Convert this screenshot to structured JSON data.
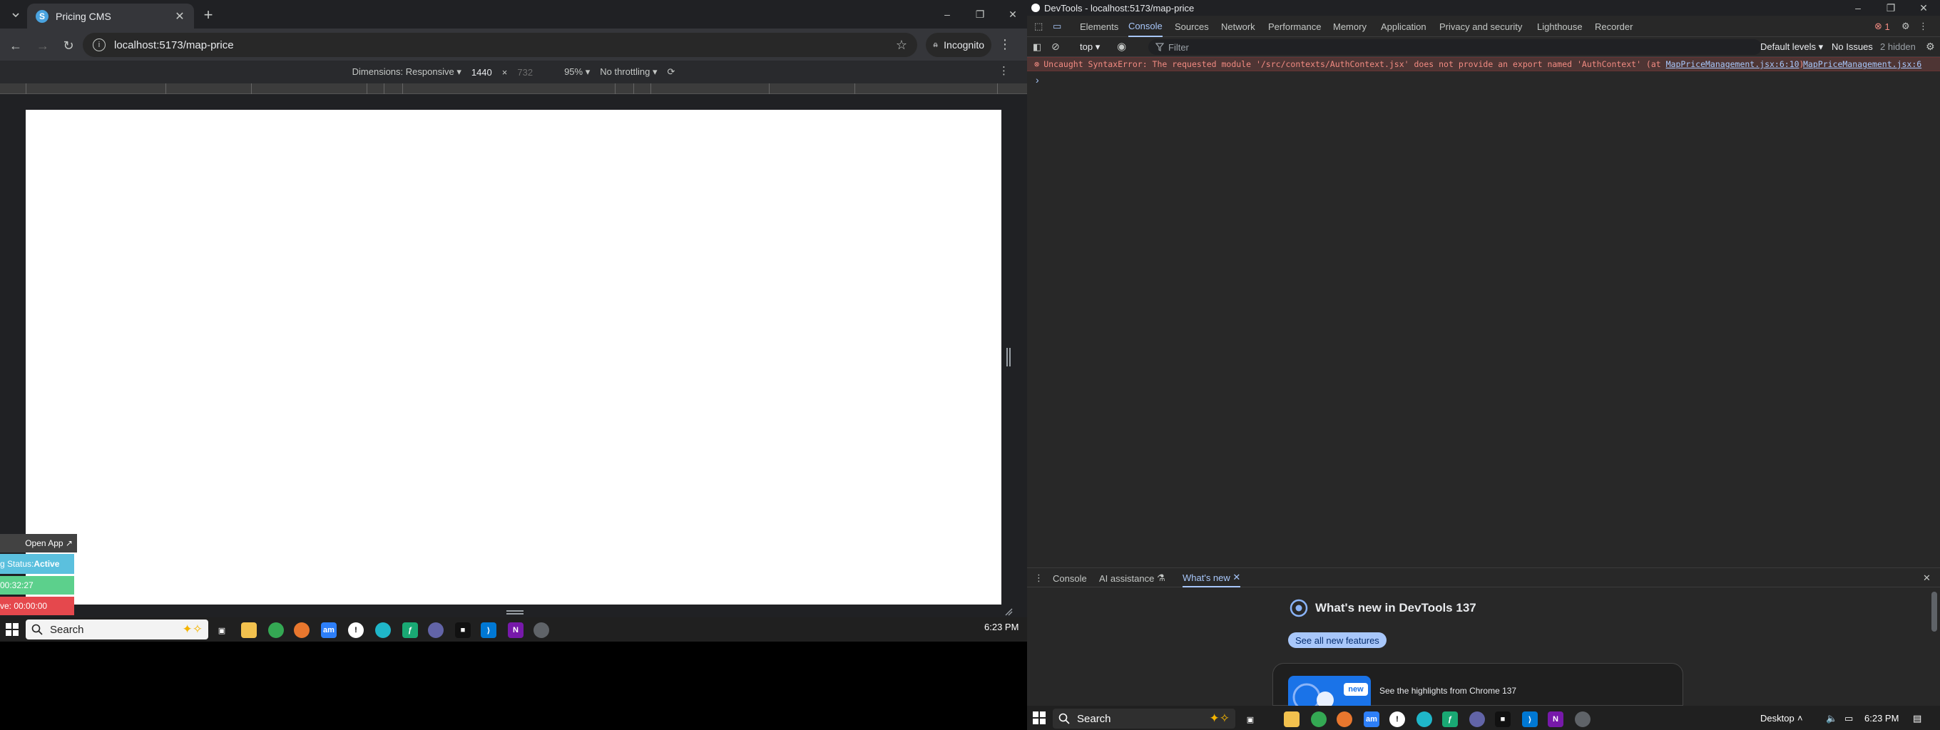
{
  "browser": {
    "tab_title": "Pricing CMS",
    "tab_favicon": "S",
    "url": "localhost:5173/map-price",
    "incognito_label": "Incognito"
  },
  "device_toolbar": {
    "dimensions_label": "Dimensions: Responsive",
    "width": "1440",
    "height": "732",
    "zoom": "95%",
    "throttling": "No throttling"
  },
  "widget": {
    "open_app": "Open App ↗",
    "status_prefix": "g Status: ",
    "status_value": "Active",
    "timer": "00:32:27",
    "inactive": "ve: 00:00:00"
  },
  "taskbar_left": {
    "search": "Search",
    "clock": "6:23 PM"
  },
  "devtools": {
    "window_title": "DevTools - localhost:5173/map-price",
    "tabs": [
      "Elements",
      "Console",
      "Sources",
      "Network",
      "Performance",
      "Memory",
      "Application",
      "Privacy and security",
      "Lighthouse",
      "Recorder"
    ],
    "error_count": "1",
    "context": "top",
    "filter_placeholder": "Filter",
    "levels": "Default levels",
    "issues": "No Issues",
    "hidden": "2 hidden",
    "error_text": "Uncaught SyntaxError: The requested module '/src/contexts/AuthContext.jsx' does not provide an export named 'AuthContext' (at ",
    "error_link": "MapPriceManagement.jsx:6:10",
    "error_close": ")",
    "error_source": "MapPriceManagement.jsx:6",
    "prompt": "›",
    "drawer_tabs": [
      "Console",
      "AI assistance",
      "What's new"
    ],
    "whats_new_title": "What's new in DevTools 137",
    "see_all": "See all new features",
    "card_badge": "new",
    "card_text": "See the highlights from Chrome 137"
  },
  "taskbar_right": {
    "search": "Search",
    "desktop": "Desktop",
    "clock": "6:23 PM"
  }
}
